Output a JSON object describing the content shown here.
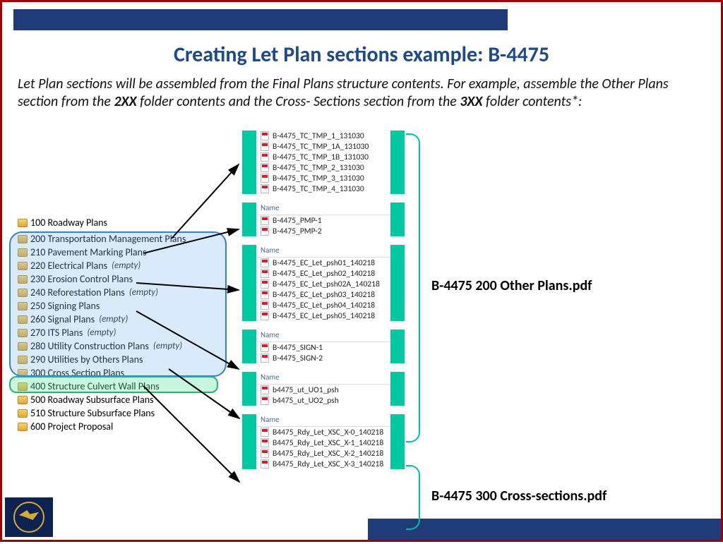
{
  "title": "Creating Let Plan sections example: B-4475",
  "intro": {
    "p1": "Let Plan sections will be assembled from the Final Plans structure contents.   For example, assemble the Other Plans section from the ",
    "b1": "2XX",
    "p2": " folder contents and the Cross- Sections section from the ",
    "b2": "3XX",
    "p3": " folder contents*:"
  },
  "tree_first": {
    "label": "100 Roadway Plans"
  },
  "tree": [
    {
      "label": "200 Transportation Management Plans",
      "empty": ""
    },
    {
      "label": "210 Pavement Marking Plans",
      "empty": ""
    },
    {
      "label": "220 Electrical Plans",
      "empty": "(empty)"
    },
    {
      "label": "230 Erosion Control Plans",
      "empty": ""
    },
    {
      "label": "240 Reforestation Plans",
      "empty": "(empty)"
    },
    {
      "label": "250 Signing Plans",
      "empty": ""
    },
    {
      "label": "260 Signal Plans",
      "empty": "(empty)"
    },
    {
      "label": "270 ITS Plans",
      "empty": "(empty)"
    },
    {
      "label": "280 Utility Construction Plans",
      "empty": "(empty)"
    },
    {
      "label": "290 Utilities by Others Plans",
      "empty": ""
    },
    {
      "label": "300 Cross Section Plans",
      "empty": ""
    },
    {
      "label": "400 Structure Culvert Wall Plans",
      "empty": ""
    },
    {
      "label": "500 Roadway Subsurface Plans",
      "empty": ""
    },
    {
      "label": "510 Structure Subsurface Plans",
      "empty": ""
    },
    {
      "label": "600 Project Proposal",
      "empty": ""
    }
  ],
  "name_header": "Name",
  "groups": [
    {
      "hdr": "",
      "files": [
        "B-4475_TC_TMP_1_131030",
        "B-4475_TC_TMP_1A_131030",
        "B-4475_TC_TMP_1B_131030",
        "B-4475_TC_TMP_2_131030",
        "B-4475_TC_TMP_3_131030",
        "B-4475_TC_TMP_4_131030"
      ]
    },
    {
      "hdr": "Name",
      "files": [
        "B-4475_PMP-1",
        "B-4475_PMP-2"
      ]
    },
    {
      "hdr": "Name",
      "files": [
        "B-4475_EC_Let_psh01_140218",
        "B-4475_EC_Let_psh02_140218",
        "B-4475_EC_Let_psh02A_140218",
        "B-4475_EC_Let_psh03_140218",
        "B-4475_EC_Let_psh04_140218",
        "B-4475_EC_Let_psh05_140218"
      ]
    },
    {
      "hdr": "Name",
      "files": [
        "B-4475_SIGN-1",
        "B-4475_SIGN-2"
      ]
    },
    {
      "hdr": "Name",
      "files": [
        "b4475_ut_UO1_psh",
        "b4475_ut_UO2_psh"
      ]
    },
    {
      "hdr": "Name",
      "files": [
        "B4475_Rdy_Let_XSC_X-0_140218",
        "B4475_Rdy_Let_XSC_X-1_140218",
        "B4475_Rdy_Let_XSC_X-2_140218",
        "B4475_Rdy_Let_XSC_X-3_140218"
      ]
    }
  ],
  "callouts": {
    "other": "B-4475 200 Other Plans.pdf",
    "cross": "B-4475 300 Cross-sections.pdf"
  }
}
